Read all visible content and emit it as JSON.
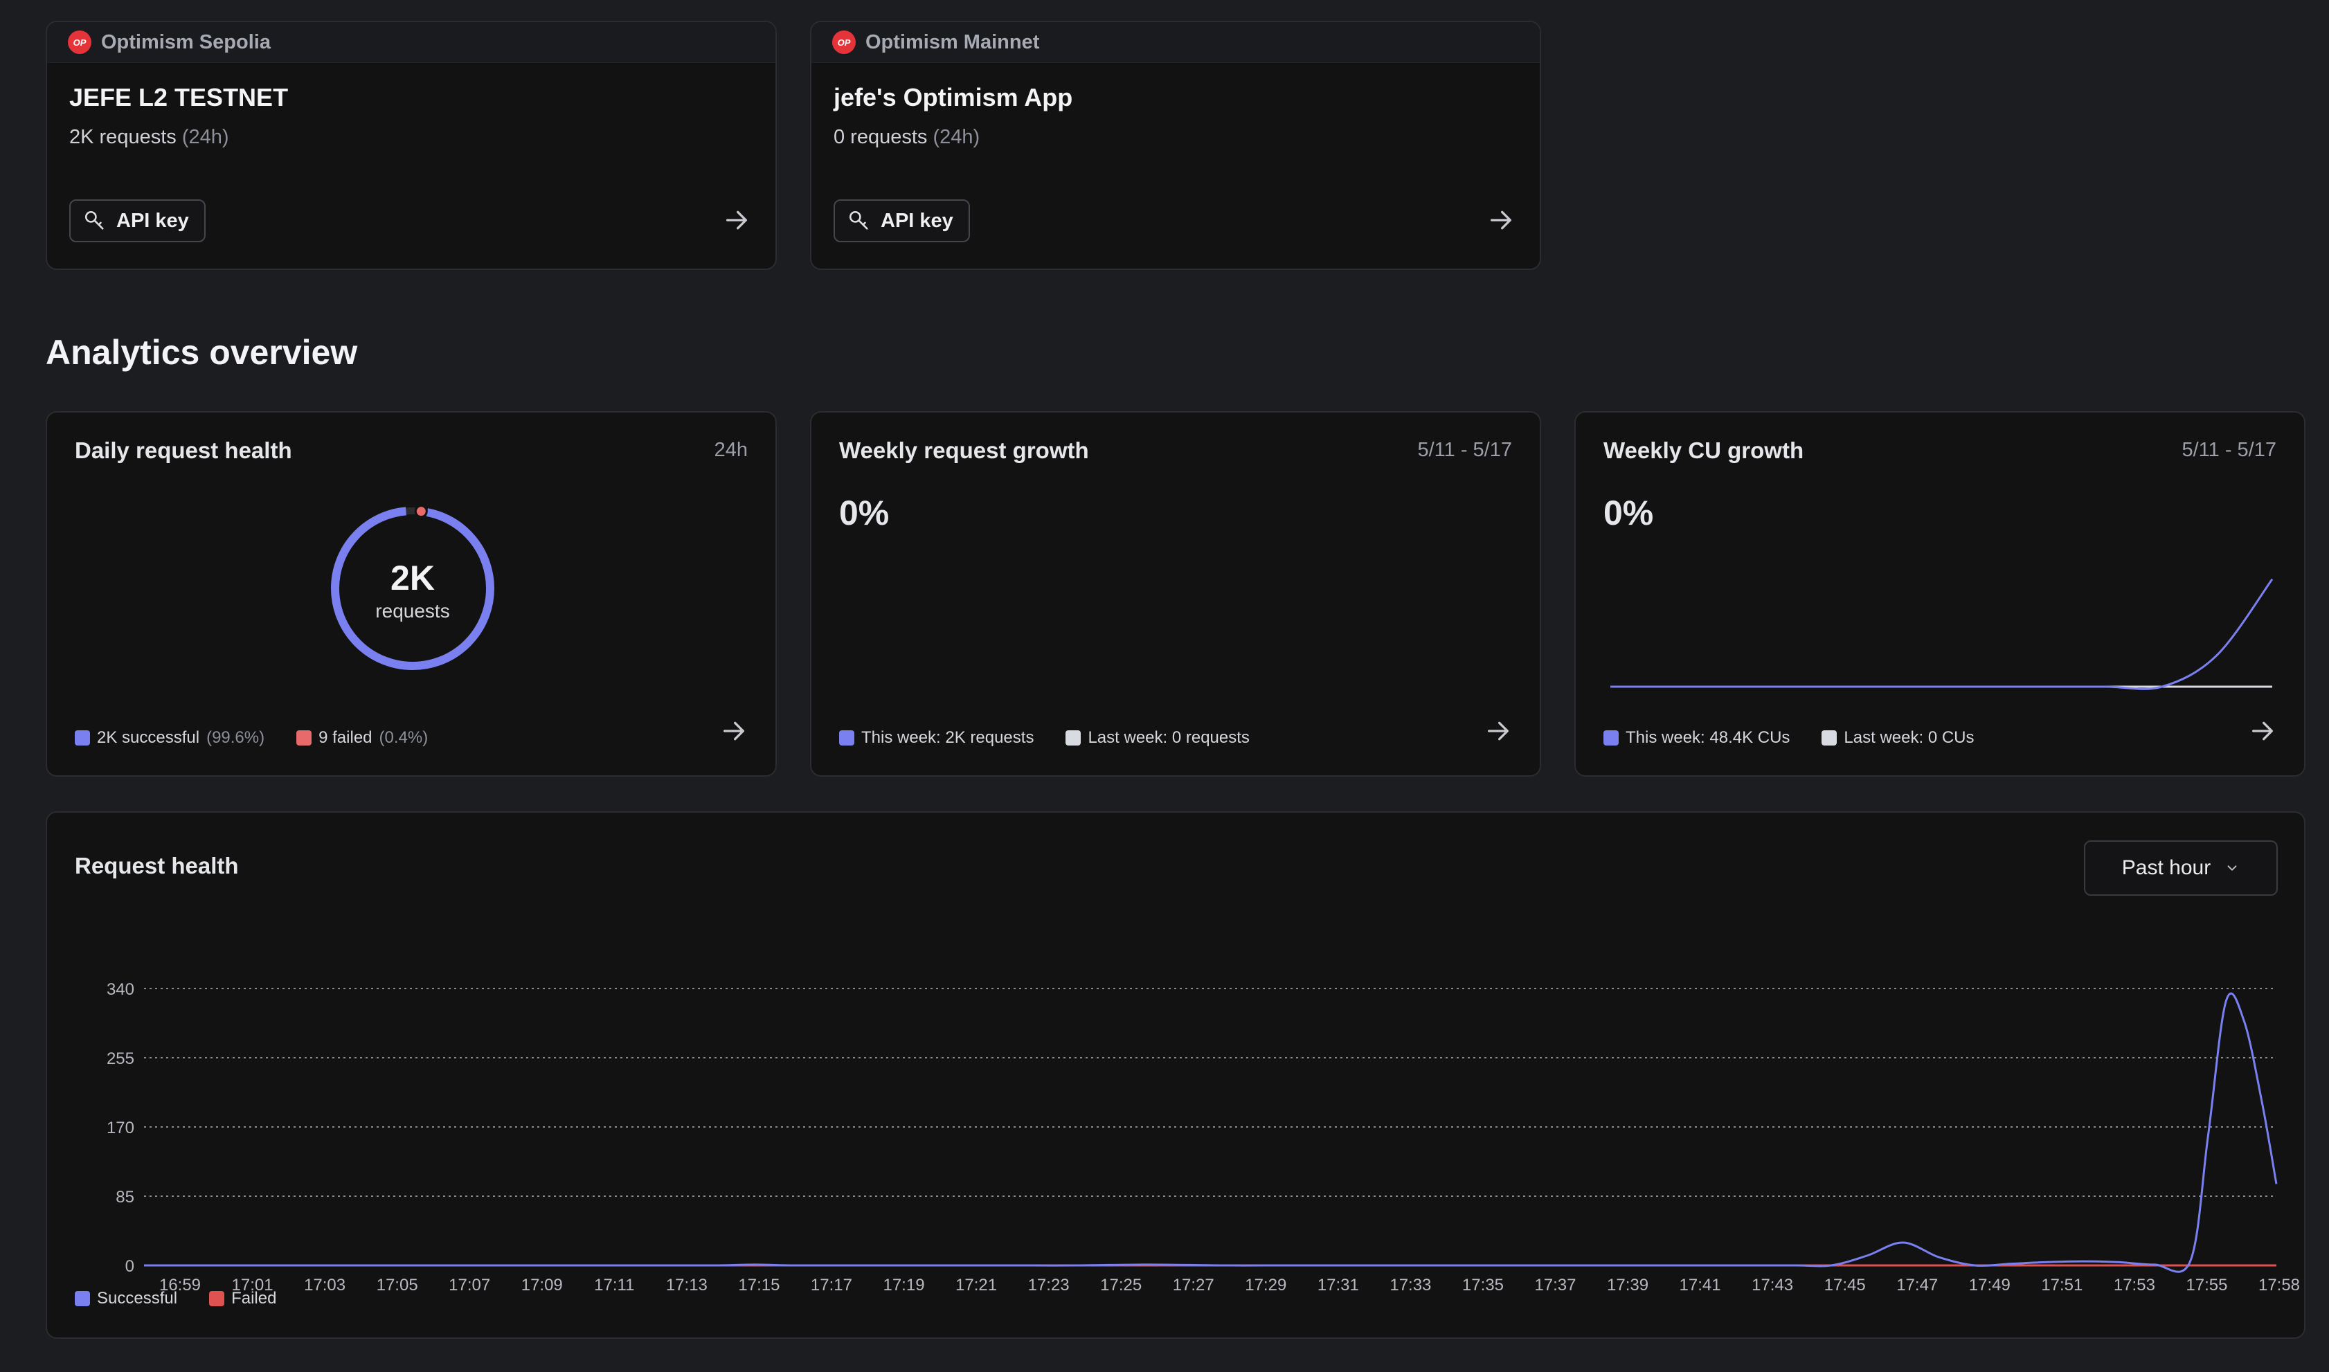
{
  "apps": [
    {
      "network": "Optimism Sepolia",
      "name": "JEFE L2 TESTNET",
      "requests": "2K requests",
      "period": "(24h)",
      "api_key_label": "API key",
      "logo_text": "OP"
    },
    {
      "network": "Optimism Mainnet",
      "name": "jefe's Optimism App",
      "requests": "0 requests",
      "period": "(24h)",
      "api_key_label": "API key",
      "logo_text": "OP"
    }
  ],
  "analytics": {
    "title": "Analytics overview",
    "daily": {
      "title": "Daily request health",
      "range": "24h",
      "center_value": "2K",
      "center_label": "requests",
      "successful_fraction": 0.996,
      "legend": [
        {
          "label": "2K successful",
          "extra": "(99.6%)",
          "color": "#7b80f0"
        },
        {
          "label": "9 failed",
          "extra": "(0.4%)",
          "color": "#e86a6a"
        }
      ]
    },
    "weekly_requests": {
      "title": "Weekly request growth",
      "range": "5/11 - 5/17",
      "value": "0%",
      "legend": [
        {
          "label": "This week: 2K requests",
          "color": "#7b80f0"
        },
        {
          "label": "Last week: 0 requests",
          "color": "#d9dbe2"
        }
      ]
    },
    "weekly_cu": {
      "title": "Weekly CU growth",
      "range": "5/11 - 5/17",
      "value": "0%",
      "legend": [
        {
          "label": "This week: 48.4K CUs",
          "color": "#7b80f0"
        },
        {
          "label": "Last week: 0 CUs",
          "color": "#d9dbe2"
        }
      ]
    }
  },
  "request_health": {
    "title": "Request health",
    "dropdown": "Past hour",
    "legend": [
      {
        "label": "Successful",
        "color": "#7b80f0"
      },
      {
        "label": "Failed",
        "color": "#e0524f"
      }
    ]
  },
  "colors": {
    "accent": "#7b80f0",
    "failed": "#e0524f"
  },
  "chart_data": [
    {
      "type": "pie",
      "title": "Daily request health",
      "categories": [
        "successful",
        "failed"
      ],
      "values": [
        99.6,
        0.4
      ]
    },
    {
      "type": "line",
      "title": "Weekly CU growth",
      "x": [
        0,
        1,
        2,
        3,
        4,
        5,
        6,
        7,
        8,
        9,
        10,
        11,
        12
      ],
      "series": [
        {
          "name": "This week",
          "values": [
            0,
            0,
            0,
            0,
            0,
            0,
            0,
            0,
            0,
            0,
            0,
            20,
            68
          ]
        },
        {
          "name": "Last week",
          "values": [
            0,
            0,
            0,
            0,
            0,
            0,
            0,
            0,
            0,
            0,
            0,
            0,
            0
          ]
        }
      ]
    },
    {
      "type": "area",
      "title": "Request health",
      "categories": [
        "16:59",
        "17:01",
        "17:03",
        "17:05",
        "17:07",
        "17:09",
        "17:11",
        "17:13",
        "17:15",
        "17:17",
        "17:19",
        "17:21",
        "17:23",
        "17:25",
        "17:27",
        "17:29",
        "17:31",
        "17:33",
        "17:35",
        "17:37",
        "17:39",
        "17:41",
        "17:43",
        "17:45",
        "17:47",
        "17:49",
        "17:51",
        "17:53",
        "17:55",
        "17:58"
      ],
      "yticks": [
        0,
        85,
        170,
        255,
        340
      ],
      "ylim": [
        0,
        340
      ],
      "x_minutes": [
        0,
        2,
        4,
        6,
        8,
        10,
        12,
        14,
        16,
        17,
        18,
        20,
        22,
        24,
        26,
        28,
        30,
        32,
        34,
        36,
        38,
        40,
        42,
        44,
        46,
        47,
        48,
        49,
        50,
        51,
        52,
        53,
        54,
        55,
        56,
        57,
        57.5,
        58,
        58.5,
        59,
        59.4
      ],
      "series": [
        {
          "name": "Successful",
          "values": [
            0,
            0,
            0,
            0,
            0,
            0,
            0,
            0,
            0,
            1,
            0,
            0,
            0,
            0,
            0,
            1,
            0,
            0,
            0,
            0,
            0,
            0,
            0,
            0,
            0,
            0,
            12,
            28,
            10,
            0,
            2,
            4,
            5,
            4,
            1,
            5,
            160,
            325,
            300,
            200,
            100
          ]
        },
        {
          "name": "Failed",
          "values": [
            0,
            0,
            0,
            0,
            0,
            0,
            0,
            0,
            0,
            0,
            0,
            0,
            0,
            0,
            0,
            0,
            0,
            0,
            0,
            0,
            0,
            0,
            0,
            0,
            0,
            0,
            0,
            0,
            0,
            0,
            0,
            0,
            0,
            0,
            0,
            0,
            0,
            0,
            0,
            0,
            0
          ]
        }
      ]
    }
  ]
}
